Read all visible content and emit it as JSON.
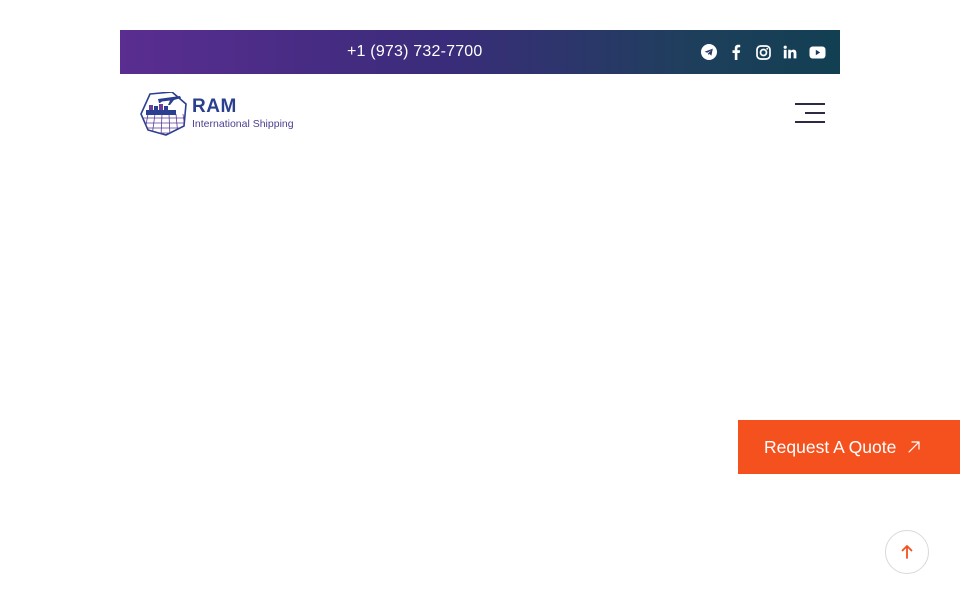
{
  "topbar": {
    "phone": "+1 (973) 732-7700",
    "socials": [
      {
        "icon": "telegram-icon"
      },
      {
        "icon": "facebook-icon"
      },
      {
        "icon": "instagram-icon"
      },
      {
        "icon": "linkedin-icon"
      },
      {
        "icon": "youtube-icon"
      }
    ]
  },
  "header": {
    "logo": {
      "name": "RAM",
      "tagline": "International Shipping"
    },
    "menu_icon": "hamburger-menu-icon"
  },
  "cta": {
    "label": "Request A Quote",
    "icon": "arrow-up-right-icon"
  },
  "scroll_top": {
    "icon": "arrow-up-icon"
  },
  "colors": {
    "topbar_start": "#5a2d91",
    "topbar_end": "#123f52",
    "cta_bg": "#f4511e",
    "scroll_arrow": "#f4511e",
    "logo_text": "#2a3f8f"
  }
}
